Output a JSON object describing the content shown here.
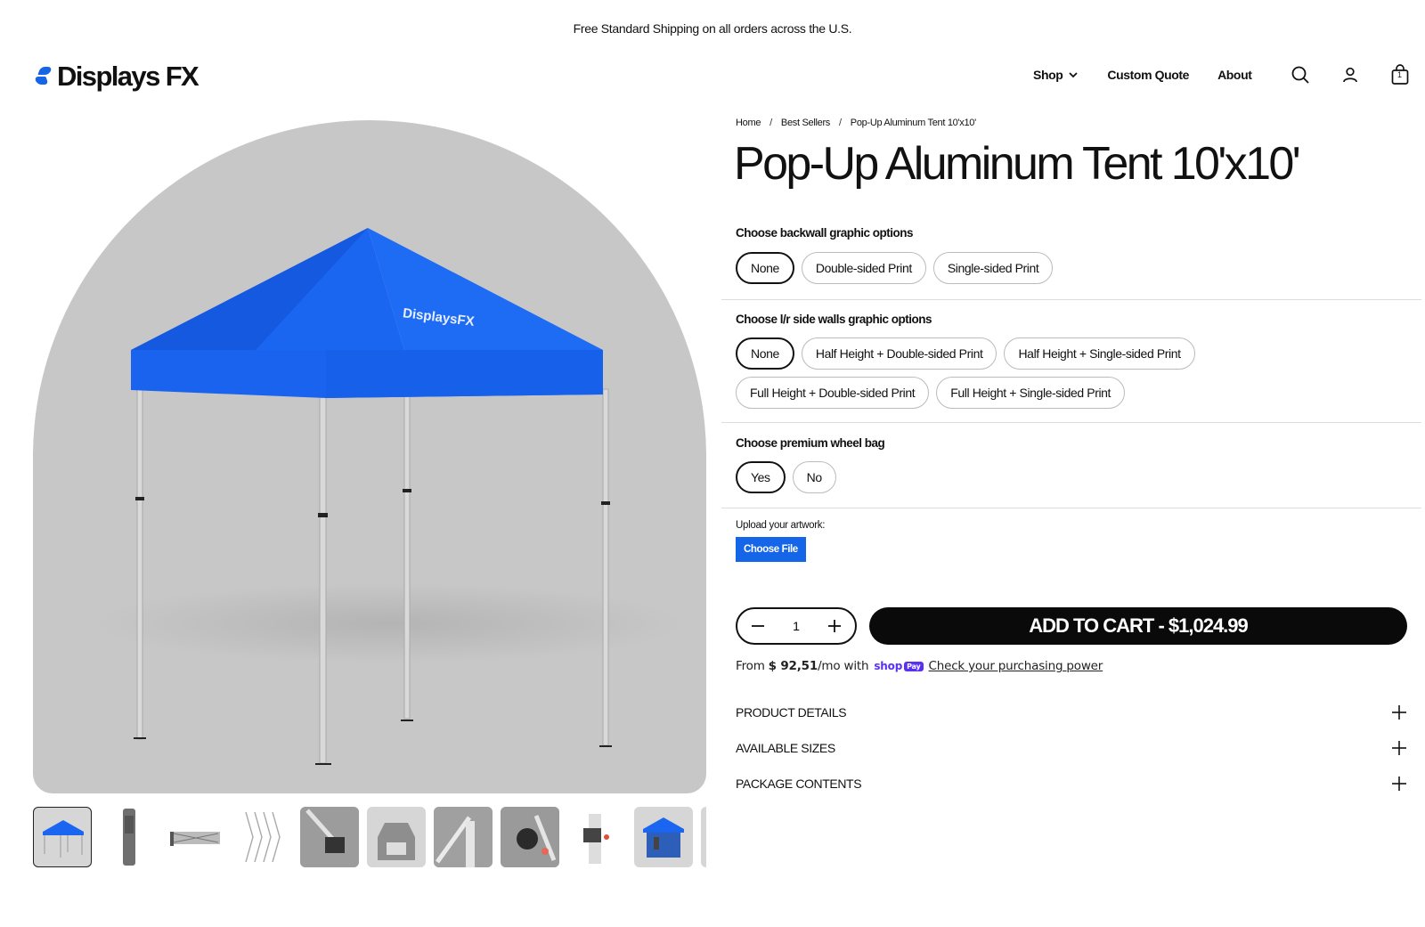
{
  "announcement": "Free Standard Shipping on all orders across the U.S.",
  "brand": {
    "name": "Displays FX",
    "accent": "#1565e8"
  },
  "nav": {
    "shop": "Shop",
    "custom_quote": "Custom Quote",
    "about": "About"
  },
  "header_icons": {
    "search": "search-icon",
    "account": "account-icon",
    "cart": "cart-icon",
    "cart_count": "1"
  },
  "gallery": {
    "tent_logo_text": "DisplaysFX",
    "thumbnails": [
      "tent-blue",
      "bag-gray",
      "frame-folded",
      "frame-open",
      "joint-detail",
      "cap-detail",
      "corner-detail",
      "bracket-detail",
      "pole-clip",
      "tent-with-walls",
      "more"
    ]
  },
  "breadcrumb": {
    "home": "Home",
    "sep": "/",
    "section": "Best Sellers",
    "current": "Pop-Up Aluminum Tent 10'x10'"
  },
  "product": {
    "title": "Pop-Up Aluminum Tent 10'x10'",
    "backwall": {
      "label": "Choose backwall graphic options",
      "options": [
        "None",
        "Double-sided Print",
        "Single-sided Print"
      ],
      "selected": "None"
    },
    "sidewalls": {
      "label": "Choose l/r side walls graphic options",
      "options": [
        "None",
        "Half Height + Double-sided Print",
        "Half Height + Single-sided Print",
        "Full Height + Double-sided Print",
        "Full Height + Single-sided Print"
      ],
      "selected": "None"
    },
    "wheelbag": {
      "label": "Choose premium wheel bag",
      "options": [
        "Yes",
        "No"
      ],
      "selected": "Yes"
    },
    "upload": {
      "label": "Upload your artwork:",
      "button": "Choose File"
    },
    "quantity": "1",
    "add_to_cart": "ADD TO CART - $1,024.99",
    "installments": {
      "prefix": "From",
      "amount": "$ 92,51",
      "suffix": "/mo with",
      "shop": "shop",
      "pay": "Pay",
      "link": "Check your purchasing power"
    },
    "accordions": [
      "PRODUCT DETAILS",
      "AVAILABLE SIZES",
      "PACKAGE CONTENTS"
    ]
  }
}
